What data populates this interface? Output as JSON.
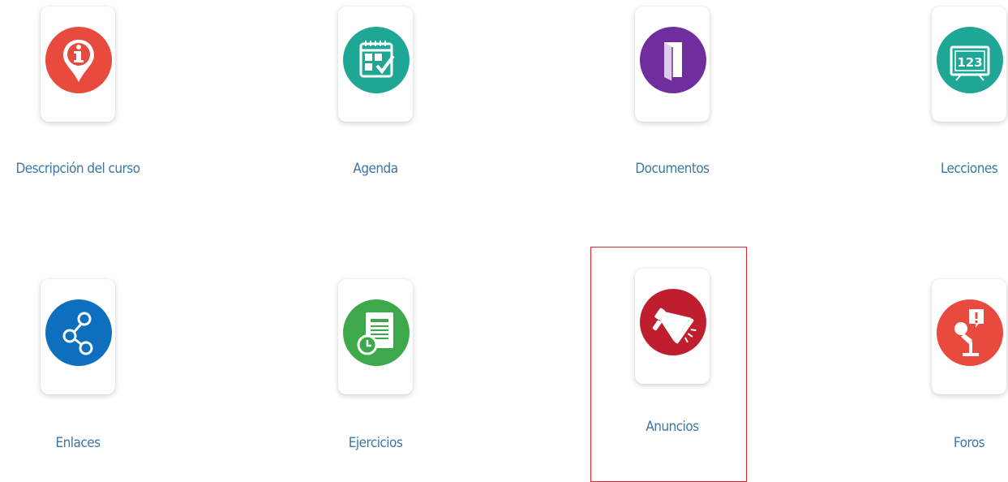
{
  "tools": [
    {
      "label": "Descripción del curso",
      "icon": "info-pin-icon",
      "color": "#e84a3d"
    },
    {
      "label": "Agenda",
      "icon": "calendar-check-icon",
      "color": "#1fa796"
    },
    {
      "label": "Documentos",
      "icon": "folder-icon",
      "color": "#6f2d9e"
    },
    {
      "label": "Lecciones",
      "icon": "lesson-board-123-icon",
      "color": "#1fa796"
    },
    {
      "label": "Enlaces",
      "icon": "share-links-icon",
      "color": "#0e6fbf"
    },
    {
      "label": "Ejercicios",
      "icon": "exercise-sheet-clock-icon",
      "color": "#3da94a"
    },
    {
      "label": "Anuncios",
      "icon": "megaphone-icon",
      "color": "#be1e2d"
    },
    {
      "label": "Foros",
      "icon": "forum-microphone-icon",
      "color": "#e84a3d"
    }
  ],
  "lesson_icon_text": "123",
  "selected_tool": "Anuncios",
  "colors": {
    "label": "#3d76a6",
    "selection_border": "#e2222c",
    "background": "#ffffff"
  }
}
